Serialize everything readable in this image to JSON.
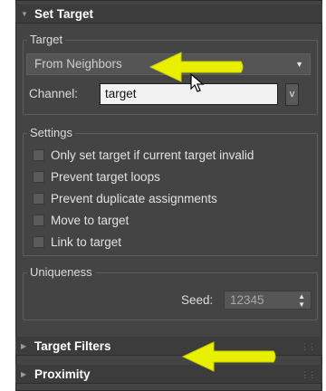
{
  "rollouts": {
    "set_target": {
      "title": "Set Target",
      "expand_icon": "triangle-down-icon"
    },
    "target_filters": {
      "title": "Target Filters",
      "expand_icon": "triangle-right-icon"
    },
    "proximity": {
      "title": "Proximity",
      "expand_icon": "triangle-right-icon"
    }
  },
  "target_group": {
    "label": "Target",
    "mode_dropdown": {
      "selected": "From Neighbors"
    },
    "channel_label": "Channel:",
    "channel_value": "target",
    "channel_button": "v"
  },
  "settings_group": {
    "label": "Settings",
    "options": [
      {
        "label": "Only set target if current target invalid",
        "checked": false
      },
      {
        "label": "Prevent target loops",
        "checked": false
      },
      {
        "label": "Prevent duplicate assignments",
        "checked": false
      },
      {
        "label": "Move to target",
        "checked": false
      },
      {
        "label": "Link to target",
        "checked": false
      }
    ]
  },
  "uniqueness_group": {
    "label": "Uniqueness",
    "seed_label": "Seed:",
    "seed_value": "12345"
  },
  "annotation_color": "#e8f000"
}
